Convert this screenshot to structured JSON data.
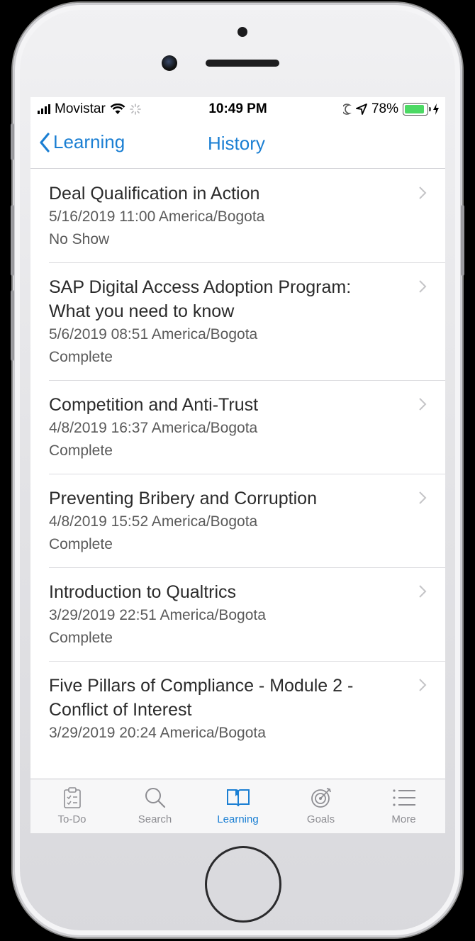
{
  "status_bar": {
    "carrier": "Movistar",
    "time": "10:49 PM",
    "battery": "78%",
    "battery_level": 0.78
  },
  "nav": {
    "back_label": "Learning",
    "title": "History"
  },
  "history": [
    {
      "title": "Deal Qualification in Action",
      "datetime": "5/16/2019 11:00 America/Bogota",
      "status": "No Show"
    },
    {
      "title": "SAP Digital Access Adoption Program: What you need to know",
      "datetime": "5/6/2019 08:51 America/Bogota",
      "status": "Complete"
    },
    {
      "title": "Competition and Anti-Trust",
      "datetime": "4/8/2019 16:37 America/Bogota",
      "status": "Complete"
    },
    {
      "title": "Preventing Bribery and Corruption",
      "datetime": "4/8/2019 15:52 America/Bogota",
      "status": "Complete"
    },
    {
      "title": "Introduction to Qualtrics",
      "datetime": "3/29/2019 22:51 America/Bogota",
      "status": "Complete"
    },
    {
      "title": "Five Pillars of Compliance - Module 2 - Conflict of Interest",
      "datetime": "3/29/2019 20:24 America/Bogota",
      "status": ""
    }
  ],
  "tabbar": {
    "todo": "To-Do",
    "search": "Search",
    "learning": "Learning",
    "goals": "Goals",
    "more": "More",
    "active": "learning"
  },
  "colors": {
    "accent": "#1b7fd3",
    "inactive": "#8e8e93",
    "battery": "#4cd964"
  }
}
